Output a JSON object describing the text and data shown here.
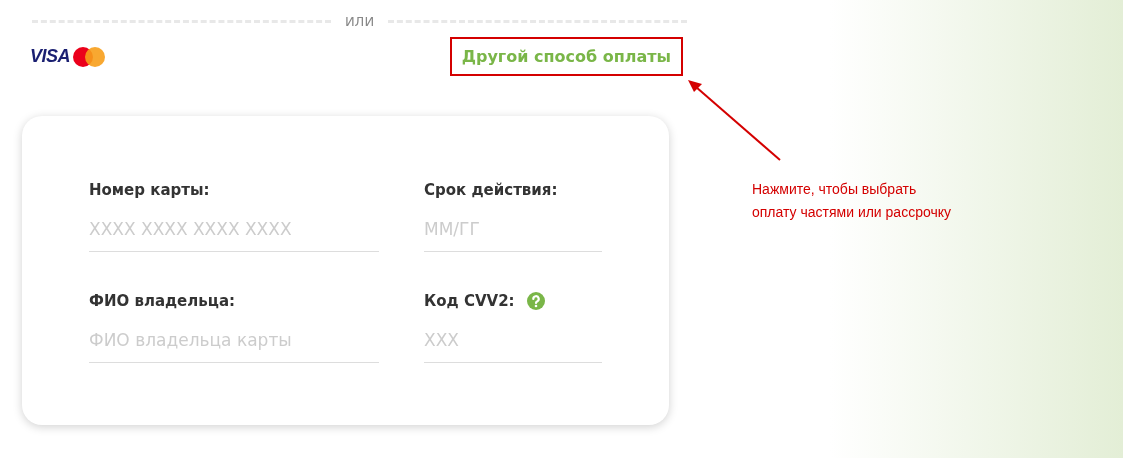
{
  "divider_label": "ИЛИ",
  "card_brand": {
    "visa_text": "VISA"
  },
  "other_payment_link": "Другой способ оплаты",
  "fields": [
    {
      "label": "Номер карты:",
      "placeholder": "XXXX XXXX XXXX XXXX",
      "help": false
    },
    {
      "label": "Срок действия:",
      "placeholder": "ММ/ГГ",
      "help": false
    },
    {
      "label": "ФИО владельца:",
      "placeholder": "ФИО владельца карты",
      "help": false
    },
    {
      "label": "Код CVV2:",
      "placeholder": "XXX",
      "help": true
    }
  ],
  "annotation": {
    "lines": [
      "Нажмите, чтобы выбрать",
      "оплату частями или рассрочку"
    ]
  }
}
